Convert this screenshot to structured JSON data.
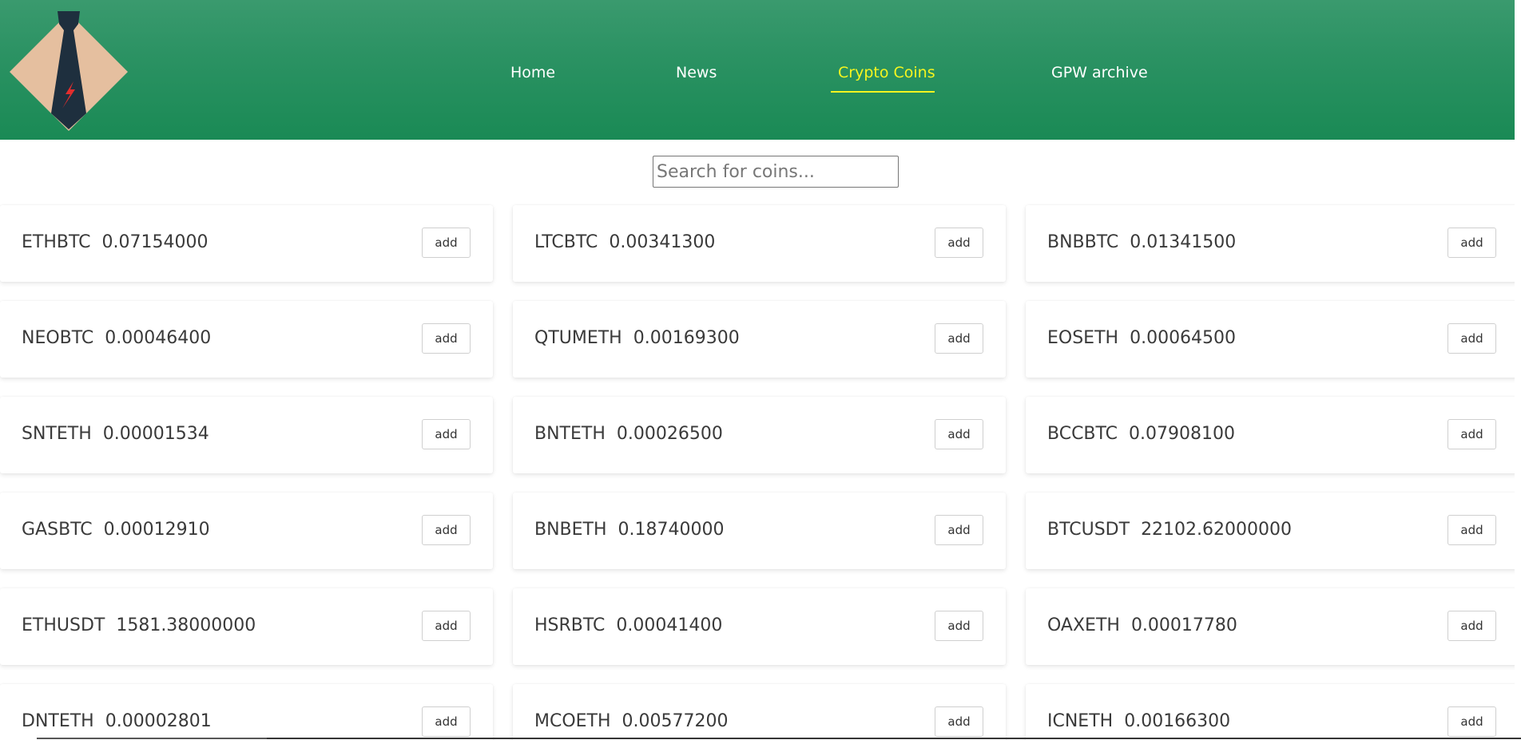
{
  "header": {
    "brand_colors": {
      "gradient_top": "#3a9a6e",
      "gradient_bottom": "#1a8a55"
    },
    "logo_icon": "tie-logo-icon",
    "nav": [
      {
        "label": "Home",
        "active": false
      },
      {
        "label": "News",
        "active": false
      },
      {
        "label": "Crypto Coins",
        "active": true
      },
      {
        "label": "GPW archive",
        "active": false
      }
    ],
    "active_color": "#f5f51f"
  },
  "search": {
    "placeholder": "Search for coins...",
    "value": ""
  },
  "coins": [
    {
      "symbol": "ETHBTC",
      "price": "0.07154000",
      "button": "add"
    },
    {
      "symbol": "LTCBTC",
      "price": "0.00341300",
      "button": "add"
    },
    {
      "symbol": "BNBBTC",
      "price": "0.01341500",
      "button": "add"
    },
    {
      "symbol": "NEOBTC",
      "price": "0.00046400",
      "button": "add"
    },
    {
      "symbol": "QTUMETH",
      "price": "0.00169300",
      "button": "add"
    },
    {
      "symbol": "EOSETH",
      "price": "0.00064500",
      "button": "add"
    },
    {
      "symbol": "SNTETH",
      "price": "0.00001534",
      "button": "add"
    },
    {
      "symbol": "BNTETH",
      "price": "0.00026500",
      "button": "add"
    },
    {
      "symbol": "BCCBTC",
      "price": "0.07908100",
      "button": "add"
    },
    {
      "symbol": "GASBTC",
      "price": "0.00012910",
      "button": "add"
    },
    {
      "symbol": "BNBETH",
      "price": "0.18740000",
      "button": "add"
    },
    {
      "symbol": "BTCUSDT",
      "price": "22102.62000000",
      "button": "add"
    },
    {
      "symbol": "ETHUSDT",
      "price": "1581.38000000",
      "button": "add"
    },
    {
      "symbol": "HSRBTC",
      "price": "0.00041400",
      "button": "add"
    },
    {
      "symbol": "OAXETH",
      "price": "0.00017780",
      "button": "add"
    },
    {
      "symbol": "DNTETH",
      "price": "0.00002801",
      "button": "add"
    },
    {
      "symbol": "MCOETH",
      "price": "0.00577200",
      "button": "add"
    },
    {
      "symbol": "ICNETH",
      "price": "0.00166300",
      "button": "add"
    }
  ]
}
